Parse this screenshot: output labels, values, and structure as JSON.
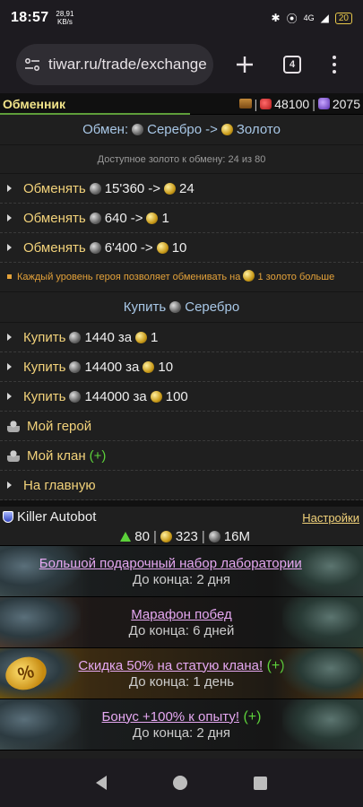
{
  "status_bar": {
    "time": "18:57",
    "speed_value": "28,91",
    "speed_unit": "KB/s",
    "network": "4G",
    "battery": "20"
  },
  "browser": {
    "url": "tiwar.ru/trade/exchange",
    "tab_count": "4"
  },
  "topbar": {
    "title": "Обменник",
    "hp": "48100",
    "mana": "2075"
  },
  "exchange": {
    "header_prefix": "Обмен:",
    "header_from": "Серебро",
    "header_arrow": "->",
    "header_to": "Золото",
    "available": "Доступное золото к обмену: 24 из 80",
    "rows": [
      {
        "action": "Обменять",
        "silver": "15'360",
        "arrow": "->",
        "gold": "24"
      },
      {
        "action": "Обменять",
        "silver": "640",
        "arrow": "->",
        "gold": "1"
      },
      {
        "action": "Обменять",
        "silver": "6'400",
        "arrow": "->",
        "gold": "10"
      }
    ],
    "hint_a": "Каждый уровень героя позволяет обменивать на",
    "hint_b": "1 золото больше"
  },
  "buy": {
    "header_prefix": "Купить",
    "header_item": "Серебро",
    "rows": [
      {
        "action": "Купить",
        "silver": "1440",
        "for": "за",
        "gold": "1"
      },
      {
        "action": "Купить",
        "silver": "14400",
        "for": "за",
        "gold": "10"
      },
      {
        "action": "Купить",
        "silver": "144000",
        "for": "за",
        "gold": "100"
      }
    ]
  },
  "nav": {
    "hero": "Мой герой",
    "clan": "Мой клан",
    "clan_plus": "(+)",
    "home": "На главную"
  },
  "player": {
    "name": "Killer Autobot",
    "settings": "Настройки",
    "level": "80",
    "gold": "323",
    "silver": "16M"
  },
  "promos": [
    {
      "title": "Большой подарочный набор лаборатории",
      "plus": "(+)",
      "subtitle": "До конца: 2 дня"
    },
    {
      "title": "Марафон побед",
      "plus": "",
      "subtitle": "До конца: 6 дней"
    },
    {
      "title": "Скидка 50% на статую клана!",
      "plus": "(+)",
      "subtitle": "До конца: 1 день",
      "badge": "%"
    },
    {
      "title": "Бонус +100% к опыту!",
      "plus": "(+)",
      "subtitle": "До конца: 2 дня"
    }
  ]
}
